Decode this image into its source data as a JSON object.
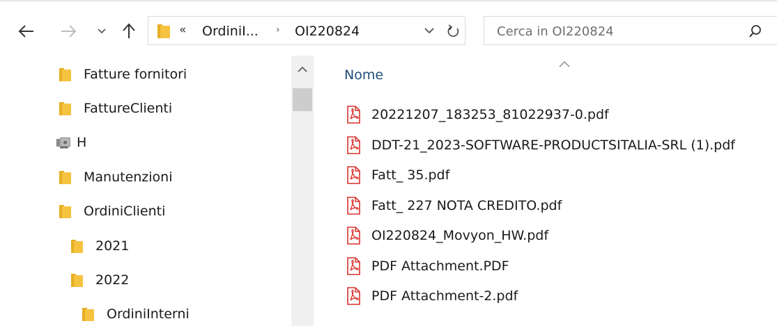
{
  "window": {
    "title": "OI220824"
  },
  "address_bar": {
    "overflow_glyph": "«",
    "crumbs": [
      "OrdiniI...",
      "OI220824"
    ],
    "separator": "›"
  },
  "search": {
    "placeholder": "Cerca in OI220824"
  },
  "tree": {
    "items": [
      {
        "label": "Fatture fornitori",
        "icon": "folder-icon"
      },
      {
        "label": "FattureClienti",
        "icon": "folder-icon"
      },
      {
        "label": "H",
        "icon": "network-drive-icon"
      },
      {
        "label": "Manutenzioni",
        "icon": "folder-icon"
      },
      {
        "label": "OrdiniClienti",
        "icon": "folder-icon"
      },
      {
        "label": "2021",
        "icon": "folder-icon"
      },
      {
        "label": "2022",
        "icon": "folder-icon"
      },
      {
        "label": "OrdiniInterni",
        "icon": "folder-icon"
      }
    ]
  },
  "file_list": {
    "column_name": "Nome",
    "files": [
      "20221207_183253_81022937-0.pdf",
      "DDT-21_2023-SOFTWARE-PRODUCTSITALIA-SRL (1).pdf",
      "Fatt_ 35.pdf",
      "Fatt_ 227 NOTA CREDITO.pdf",
      "OI220824_Movyon_HW.pdf",
      "PDF Attachment.PDF",
      "PDF Attachment-2.pdf"
    ]
  },
  "colors": {
    "folder": "#f6c341",
    "pdf_red": "#d9302c",
    "header_text": "#1f4e79",
    "border": "#d9d9d9"
  }
}
